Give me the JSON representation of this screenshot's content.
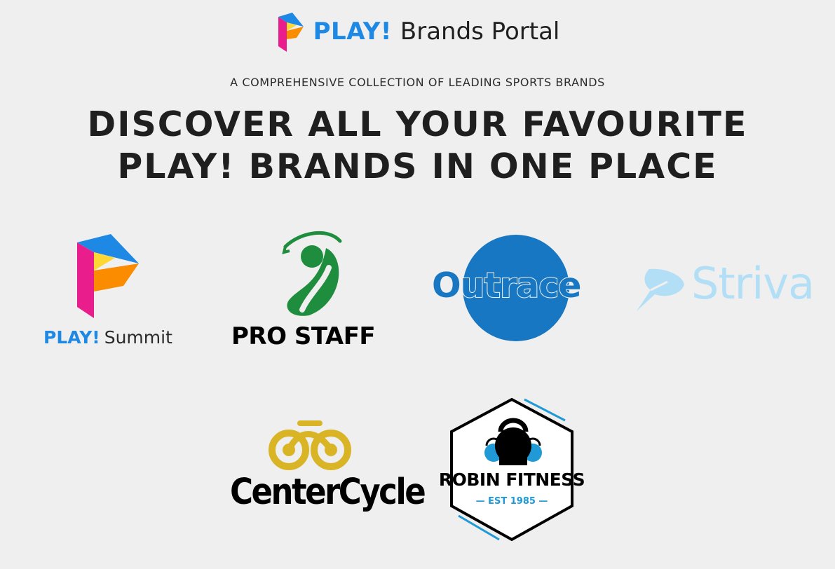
{
  "header": {
    "brand": "PLAY!",
    "portal": "Brands Portal",
    "logo_icon": "play-p-logo-icon"
  },
  "tagline": "A COMPREHENSIVE COLLECTION OF LEADING SPORTS BRANDS",
  "headline": {
    "line1": "DISCOVER ALL YOUR FAVOURITE",
    "line2": "PLAY! BRANDS IN ONE PLACE"
  },
  "brands": [
    {
      "id": "play-summit",
      "prefix": "PLAY!",
      "name": "Summit",
      "icon": "play-p-logo-icon"
    },
    {
      "id": "pro-staff",
      "name": "PRO STAFF",
      "icon": "golfer-swing-icon"
    },
    {
      "id": "outrace",
      "name": "Outrace",
      "icon": "blue-circle-emblem"
    },
    {
      "id": "striva",
      "name": "Striva",
      "icon": "dart-arrow-icon"
    },
    {
      "id": "centercycle",
      "name": "CenterCycle",
      "icon": "bicycle-icon"
    },
    {
      "id": "robin-fitness",
      "name": "ROBIN FITNESS",
      "tagline": "— EST 1985 —",
      "icon": "kettlebell-icon"
    }
  ],
  "colors": {
    "background": "#efefef",
    "play_blue": "#1e88e5",
    "play_pink": "#e91e8c",
    "play_orange": "#fb8c00",
    "play_yellow": "#fdd835",
    "prostaff_green": "#1e8e3e",
    "outrace_blue": "#1777c2",
    "striva_light_blue": "#b3dff6",
    "centercycle_gold": "#d9b526",
    "robin_cyan": "#1f9ad6"
  }
}
